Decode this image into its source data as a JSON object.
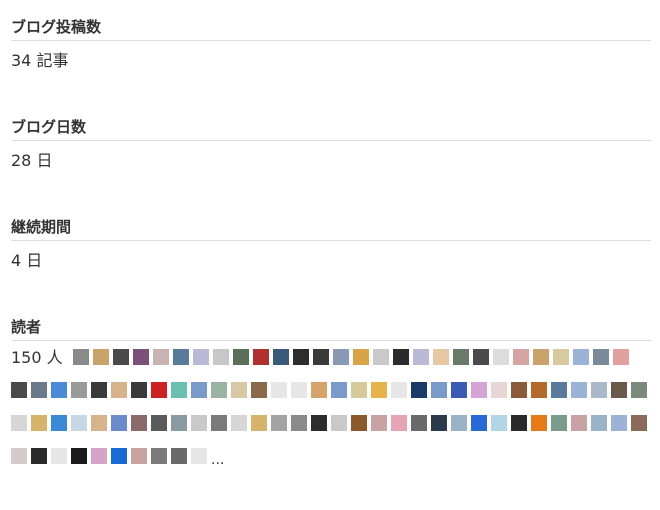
{
  "stats": [
    {
      "label": "ブログ投稿数",
      "value": "34 記事"
    },
    {
      "label": "ブログ日数",
      "value": "28 日"
    },
    {
      "label": "継続期間",
      "value": "4 日"
    }
  ],
  "readers": {
    "label": "読者",
    "count": "150 人",
    "more": "...",
    "avatar_colors": [
      "#8a8a8a",
      "#c9a36b",
      "#4a4a4a",
      "#7a4f7a",
      "#c8b2b2",
      "#5a7a9a",
      "#b9b9d6",
      "#c7c7c7",
      "#5a6e5a",
      "#b03030",
      "#3a5a7a",
      "#2d2d2d",
      "#3a3a3a",
      "#8a99b3",
      "#d9a34a",
      "#c9c9c9",
      "#2b2b2b",
      "#b9b9d6",
      "#e6c9a3",
      "#6a7a6a",
      "#4a4a4a",
      "#dcdcdc",
      "#d6a3a3",
      "#c9a36b",
      "#d9c9a3",
      "#9ab3d6",
      "#7a8a9a",
      "#e0a0a0",
      "#4a4a4a",
      "#6a7a8a",
      "#4a8ad6",
      "#9a9a9a",
      "#3a3a3a",
      "#d6b38a",
      "#3a3a3a",
      "#cc2222",
      "#6abfb0",
      "#7a9ac9",
      "#9ab3a3",
      "#d6c9a3",
      "#8a6a4a",
      "#e6e6e6",
      "#e6e6e6",
      "#d6a36a",
      "#7a9ac9",
      "#d6c99a",
      "#e6b34a",
      "#e6e6e6",
      "#1a3a6a",
      "#7a9ac9",
      "#3a5ab3",
      "#d6a3d6",
      "#e6d6d6",
      "#8a5a3a",
      "#b36a2a",
      "#5a7a9a",
      "#9ab3d6",
      "#a9b9c9",
      "#6a5a4a",
      "#7a8a7a",
      "#d6d6d6",
      "#d6b36a",
      "#3a8ad6",
      "#c9d6e6",
      "#d6b38a",
      "#6a8ac9",
      "#8a6a6a",
      "#5a5a5a",
      "#8a9aa3",
      "#c9c9c9",
      "#7a7a7a",
      "#d6d6d6",
      "#d6b36a",
      "#a3a3a3",
      "#8a8a8a",
      "#2d2d2d",
      "#c9c9c9",
      "#8a5a2a",
      "#c9a3a3",
      "#e6a3b3",
      "#6a6a6a",
      "#2a3a4a",
      "#9ab3c9",
      "#2a6ad6",
      "#b3d6e6",
      "#2a2a2a",
      "#e67a1a",
      "#7a9a8a",
      "#c9a3a3",
      "#9ab3c9",
      "#9ab3d6",
      "#8a6a5a",
      "#d6c9c9",
      "#2a2a2a",
      "#e6e6e6",
      "#1a1a1a",
      "#d6a3c9",
      "#1a6ad6",
      "#c9a3a3",
      "#7a7a7a",
      "#6a6a6a",
      "#e6e6e6"
    ]
  }
}
